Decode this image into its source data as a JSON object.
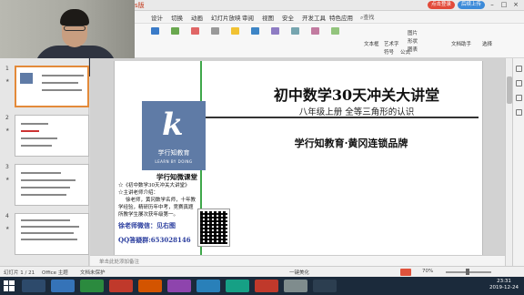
{
  "titlebar": {
    "app": "s版",
    "login_pill": "点击登录",
    "share_pill": "后续上传"
  },
  "menu": {
    "items": [
      "设计",
      "切换",
      "动画",
      "幻灯片放映",
      "审阅",
      "视图",
      "安全",
      "开发工具",
      "特色应用"
    ],
    "search": "查找"
  },
  "ribbon": {
    "labels": [
      "文本框",
      "艺术字",
      "符号",
      "公式",
      "图片",
      "形状",
      "图表",
      "文档助手",
      "选择"
    ]
  },
  "thumbnails": [
    {
      "num": "1"
    },
    {
      "num": "2"
    },
    {
      "num": "3"
    },
    {
      "num": "4"
    }
  ],
  "slide": {
    "title": "初中数学30天冲关大讲堂",
    "subtitle": "八年级上册    全等三角形的认识",
    "brand": "学行知教育·黄冈连锁品牌",
    "logo_letter": "k",
    "logo_text": "学行知教育",
    "logo_en": "LEARN BY DOING",
    "info_title": "学行知微课堂",
    "info_lines": [
      "☆《初中数学30天冲关大讲堂》",
      "☆主讲老师介绍：",
      "徐老师，黄冈数学名师，十年教",
      "学经验，精研历年中考，竞赛真题",
      "所教学生屡次获年级第一。"
    ],
    "teacher_line": "徐老师微信：见右图",
    "qq_line": "QQ答疑群:653028146"
  },
  "notes": {
    "placeholder": "单击此处添加备注"
  },
  "status": {
    "page": "幻灯片 1 / 21",
    "theme": "Office 主题",
    "backup": "文档未保护",
    "beautify": "一键美化",
    "zoom": "70%"
  },
  "taskbar": {
    "time": "23:31",
    "date": "2019-12-24"
  }
}
